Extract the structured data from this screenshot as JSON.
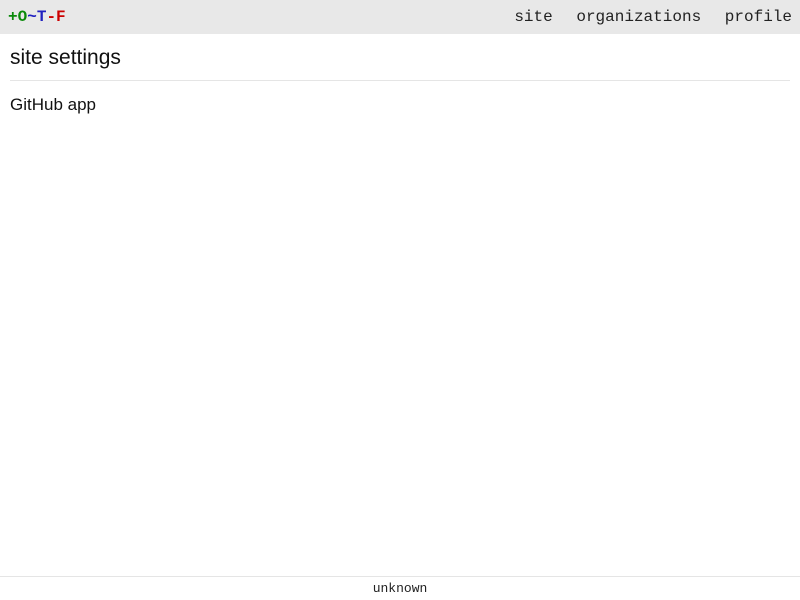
{
  "logo": {
    "plus": "+",
    "o": "O",
    "tilde": "~",
    "t": "T",
    "dash": "-",
    "f": "F"
  },
  "nav": {
    "site": "site",
    "organizations": "organizations",
    "profile": "profile"
  },
  "page": {
    "title": "site settings",
    "github_link": "GitHub app"
  },
  "footer": {
    "version": "unknown"
  }
}
